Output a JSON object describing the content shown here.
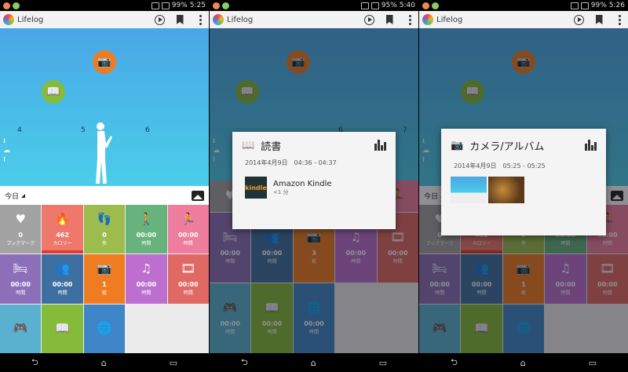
{
  "panels": [
    {
      "status_time": "5:25",
      "battery": "99%"
    },
    {
      "status_time": "5:40",
      "battery": "95%"
    },
    {
      "status_time": "5:26",
      "battery": "99%"
    }
  ],
  "app_title": "Lifelog",
  "timeline_ticks": [
    "4",
    "5",
    "6",
    "7"
  ],
  "date_label": "今日",
  "tiles": [
    {
      "icon": "bookmark-icon",
      "glyph": "♥",
      "value": "0",
      "unit": "ブックマーク",
      "color": "#a3a3a3"
    },
    {
      "icon": "flame-icon",
      "glyph": "🔥",
      "value": "462",
      "unit": "カロリー",
      "color": "#ee786c",
      "bar": true
    },
    {
      "icon": "steps-icon",
      "glyph": "👣",
      "value": "0",
      "unit": "歩",
      "color": "#9cbd4d"
    },
    {
      "icon": "walking-icon",
      "glyph": "🚶",
      "value": "00:00",
      "unit": "時間",
      "color": "#67b27d"
    },
    {
      "icon": "running-icon",
      "glyph": "🏃",
      "value": "00:00",
      "unit": "時間",
      "color": "#ef7d9d"
    },
    {
      "icon": "bed-icon",
      "glyph": "🛏",
      "value": "00:00",
      "unit": "時間",
      "color": "#8d6fb9"
    },
    {
      "icon": "people-icon",
      "glyph": "👥",
      "value": "00:00",
      "unit": "時間",
      "color": "#3e6fa1"
    },
    {
      "icon": "camera-icon",
      "glyph": "📷",
      "value": "1",
      "unit": "枚",
      "color": "#f07c22"
    },
    {
      "icon": "music-icon",
      "glyph": "♫",
      "value": "00:00",
      "unit": "時間",
      "color": "#bd6fcf"
    },
    {
      "icon": "film-icon",
      "glyph": "🎞",
      "value": "00:00",
      "unit": "時間",
      "color": "#e06965"
    },
    {
      "icon": "gamepad-icon",
      "glyph": "🎮",
      "value": "",
      "unit": "",
      "color": "#59b1cf"
    },
    {
      "icon": "book-icon",
      "glyph": "📖",
      "value": "",
      "unit": "",
      "color": "#84bb3a"
    },
    {
      "icon": "globe-icon",
      "glyph": "🌐",
      "value": "",
      "unit": "",
      "color": "#3f86c8"
    }
  ],
  "panel2_tiles": [
    {
      "icon": "bed-icon",
      "glyph": "🛏",
      "value": "00:00",
      "unit": "時間",
      "color": "#8d6fb9"
    },
    {
      "icon": "people-icon",
      "glyph": "👥",
      "value": "00:00",
      "unit": "時間",
      "color": "#3e6fa1"
    },
    {
      "icon": "camera-icon",
      "glyph": "📷",
      "value": "3",
      "unit": "枚",
      "color": "#f07c22"
    },
    {
      "icon": "music-icon",
      "glyph": "♫",
      "value": "00:00",
      "unit": "時間",
      "color": "#bd6fcf"
    },
    {
      "icon": "film-icon",
      "glyph": "🎞",
      "value": "00:00",
      "unit": "時間",
      "color": "#e06965"
    },
    {
      "icon": "gamepad-icon",
      "glyph": "🎮",
      "value": "00:00",
      "unit": "時間",
      "color": "#59b1cf"
    },
    {
      "icon": "book-icon",
      "glyph": "📖",
      "value": "00:00",
      "unit": "時間",
      "color": "#84bb3a"
    },
    {
      "icon": "globe-icon",
      "glyph": "🌐",
      "value": "00:00",
      "unit": "時間",
      "color": "#3f86c8"
    }
  ],
  "reading_card": {
    "title": "読書",
    "datetime": "2014年4月9日　04:36 - 04:37",
    "app_name": "Amazon Kindle",
    "app_thumb": "kindle",
    "duration": "<1 分"
  },
  "camera_card": {
    "title": "カメラ/アルバム",
    "datetime": "2014年4月9日　05:25 - 05:25"
  },
  "colors": {
    "hero_top": "#4aa6e6",
    "hero_bottom": "#4ccde9",
    "camera": "#f07c22",
    "book": "#84bb3a"
  }
}
